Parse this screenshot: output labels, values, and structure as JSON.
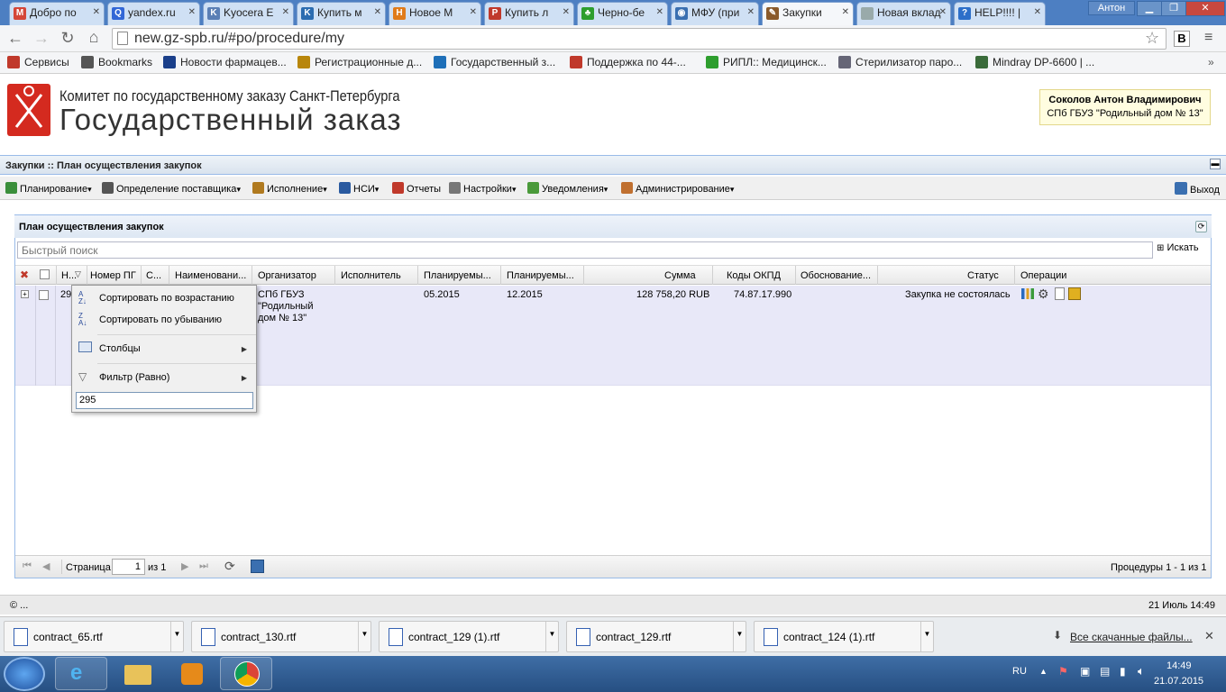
{
  "browser": {
    "tabs": [
      {
        "label": "Добро по",
        "icon": "gmail-icon",
        "color": "#d44638",
        "glyph": "M"
      },
      {
        "label": "yandex.ru",
        "icon": "yandex-icon",
        "color": "#3367d6",
        "glyph": "Q"
      },
      {
        "label": "Kyocera E",
        "icon": "doc-icon",
        "color": "#5a7fb5",
        "glyph": "K"
      },
      {
        "label": "Купить м",
        "icon": "arrow-icon",
        "color": "#2b6cb0",
        "glyph": "K"
      },
      {
        "label": "Новое М",
        "icon": "orange-icon",
        "color": "#e07b1a",
        "glyph": "Н"
      },
      {
        "label": "Купить л",
        "icon": "p-icon",
        "color": "#c0392b",
        "glyph": "P"
      },
      {
        "label": "Черно-бе",
        "icon": "clover-icon",
        "color": "#2e9e2e",
        "glyph": "♣"
      },
      {
        "label": "МФУ (при",
        "icon": "globe-icon",
        "color": "#3a6fb0",
        "glyph": "◉"
      },
      {
        "label": "Закупки",
        "icon": "tool-icon",
        "color": "#8a5a2b",
        "glyph": "✎"
      },
      {
        "label": "Новая вклад",
        "icon": "newtab-icon",
        "color": "#9aa",
        "glyph": ""
      },
      {
        "label": "HELP!!!! |",
        "icon": "help-icon",
        "color": "#2d6fc9",
        "glyph": "?"
      }
    ],
    "profile": "Антон",
    "url": "new.gz-spb.ru/#po/procedure/my",
    "bookmarks": [
      {
        "label": "Сервисы",
        "color": "#c0392b"
      },
      {
        "label": "Bookmarks",
        "color": "#555"
      },
      {
        "label": "Новости фармацев...",
        "color": "#1a3f8a"
      },
      {
        "label": "Регистрационные д...",
        "color": "#b8860b"
      },
      {
        "label": "Государственный з...",
        "color": "#1e6fb8"
      },
      {
        "label": "Поддержка по 44-...",
        "color": "#c0392b"
      },
      {
        "label": "РИПЛ:: Медицинск...",
        "color": "#2e9e2e"
      },
      {
        "label": "Стерилизатор паро...",
        "color": "#667"
      },
      {
        "label": "Mindray DP-6600 | ...",
        "color": "#3a6b3a"
      }
    ]
  },
  "header": {
    "org_line": "Комитет по государственному заказу Санкт-Петербурга",
    "site_title": "Государственный заказ",
    "user_name": "Соколов Антон Владимирович",
    "user_org": "СПб ГБУЗ \"Родильный дом № 13\""
  },
  "app": {
    "breadcrumb": "Закупки :: План осуществления закупок",
    "menu": [
      {
        "label": "Планирование",
        "dropdown": true
      },
      {
        "label": "Определение поставщика",
        "dropdown": true
      },
      {
        "label": "Исполнение",
        "dropdown": true
      },
      {
        "label": "НСИ",
        "dropdown": true
      },
      {
        "label": "Отчеты",
        "dropdown": false
      },
      {
        "label": "Настройки",
        "dropdown": true
      },
      {
        "label": "Уведомления",
        "dropdown": true
      },
      {
        "label": "Администрирование",
        "dropdown": true
      }
    ],
    "exit_label": "Выход"
  },
  "panel": {
    "title": "План осуществления закупок",
    "search_placeholder": "Быстрый поиск",
    "search_button": "Искать",
    "columns": [
      "Н...",
      "Номер ПГ",
      "С...",
      "Наименовани...",
      "Организатор",
      "Исполнитель",
      "Планируемы...",
      "Планируемы...",
      "Сумма",
      "Коды ОКПД",
      "Обоснование...",
      "Статус",
      "Операции"
    ],
    "row": {
      "number": "29",
      "organizer": [
        "СПб ГБУЗ",
        "\"Родильный",
        "дом № 13\""
      ],
      "plan_start": "05.2015",
      "plan_end": "12.2015",
      "sum": "128 758,20 RUB",
      "okpd": "74.87.17.990",
      "status": "Закупка не состоялась"
    },
    "pager": {
      "page_label": "Страница",
      "page_value": "1",
      "of_label": "из 1",
      "summary": "Процедуры 1 - 1 из 1"
    }
  },
  "context_menu": {
    "sort_asc": "Сортировать по возрастанию",
    "sort_desc": "Сортировать по убыванию",
    "columns": "Столбцы",
    "filter": "Фильтр (Равно)",
    "filter_value": "295"
  },
  "footer": {
    "left": "© ...",
    "right": "21 Июль 14:49"
  },
  "downloads": {
    "files": [
      "contract_65.rtf",
      "contract_130.rtf",
      "contract_129 (1).rtf",
      "contract_129.rtf",
      "contract_124 (1).rtf"
    ],
    "all_label": "Все скачанные файлы..."
  },
  "taskbar": {
    "lang": "RU",
    "time": "14:49",
    "date": "21.07.2015"
  }
}
